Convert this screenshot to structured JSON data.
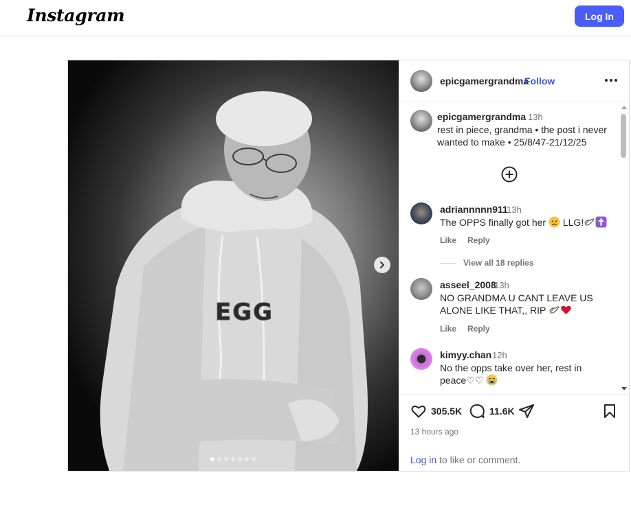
{
  "nav": {
    "logo": "Instagram",
    "login_label": "Log In"
  },
  "post": {
    "carousel": {
      "slide_count": 7,
      "active_index": 0
    },
    "header": {
      "username": "epicgamergrandma",
      "separator": "•",
      "follow_label": "Follow"
    },
    "caption": {
      "username": "epicgamergrandma",
      "time": "13h",
      "text": "rest in piece, grandma • the post i never wanted to make • 25/8/47-21/12/25"
    },
    "comments": [
      {
        "username": "adriannnnn911",
        "time": "13h",
        "text": "The OPPS finally got her",
        "text_after": "LLG!",
        "like_label": "Like",
        "reply_label": "Reply",
        "view_replies": "View all 18 replies"
      },
      {
        "username": "asseel_2008",
        "time": "13h",
        "text": "NO GRANDMA U CANT LEAVE US ALONE LIKE THAT,, RIP",
        "like_label": "Like",
        "reply_label": "Reply"
      },
      {
        "username": "kimyy.chan",
        "time": "12h",
        "text": "No the opps take over her, rest in peace♡♡"
      }
    ],
    "likes_count": "305.5K",
    "comments_count": "11.6K",
    "time_ago": "13 hours ago",
    "login_prompt": {
      "link": "Log in",
      "rest": " to like or comment."
    }
  },
  "colors": {
    "accent": "#4a5df9",
    "link": "#3e5ad6",
    "muted": "#737373"
  }
}
